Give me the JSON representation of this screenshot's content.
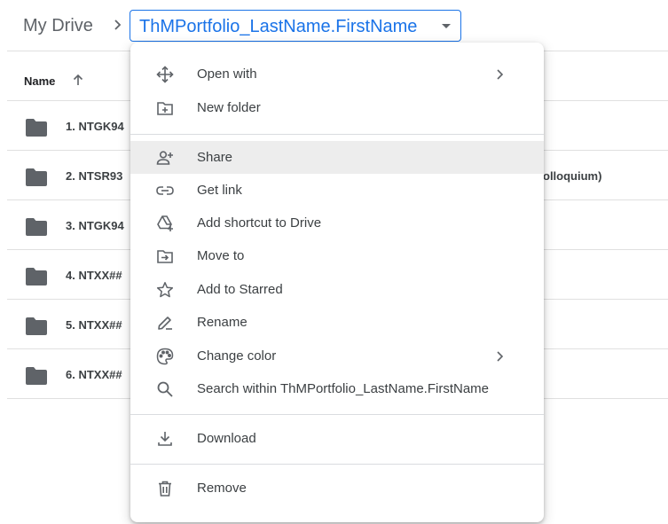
{
  "breadcrumb": {
    "root": "My Drive",
    "current": "ThMPortfolio_LastName.FirstName"
  },
  "list": {
    "column_name": "Name",
    "rows": [
      {
        "label": "1. NTGK94",
        "extra": ""
      },
      {
        "label": "2. NTSR93",
        "extra": "olloquium)"
      },
      {
        "label": "3. NTGK94",
        "extra": ""
      },
      {
        "label": "4. NTXX##",
        "extra": ""
      },
      {
        "label": "5. NTXX##",
        "extra": ""
      },
      {
        "label": "6. NTXX##",
        "extra": ""
      }
    ]
  },
  "menu": {
    "open_with": "Open with",
    "new_folder": "New folder",
    "share": "Share",
    "get_link": "Get link",
    "add_shortcut": "Add shortcut to Drive",
    "move_to": "Move to",
    "add_starred": "Add to Starred",
    "rename": "Rename",
    "change_color": "Change color",
    "search_within": "Search within ThMPortfolio_LastName.FirstName",
    "download": "Download",
    "remove": "Remove",
    "highlighted_item": "Share"
  },
  "icons": {
    "open_with": "move-arrows-icon",
    "new_folder": "new-folder-icon",
    "share": "add-person-icon",
    "get_link": "link-icon",
    "add_shortcut": "drive-shortcut-icon",
    "move_to": "move-to-folder-icon",
    "add_starred": "star-icon",
    "rename": "pencil-icon",
    "change_color": "palette-icon",
    "search_within": "search-icon",
    "download": "download-icon",
    "remove": "trash-icon"
  },
  "colors": {
    "accent": "#1a73e8",
    "folder": "#5f6368",
    "highlight": "#ededed",
    "text": "#3c4043"
  }
}
